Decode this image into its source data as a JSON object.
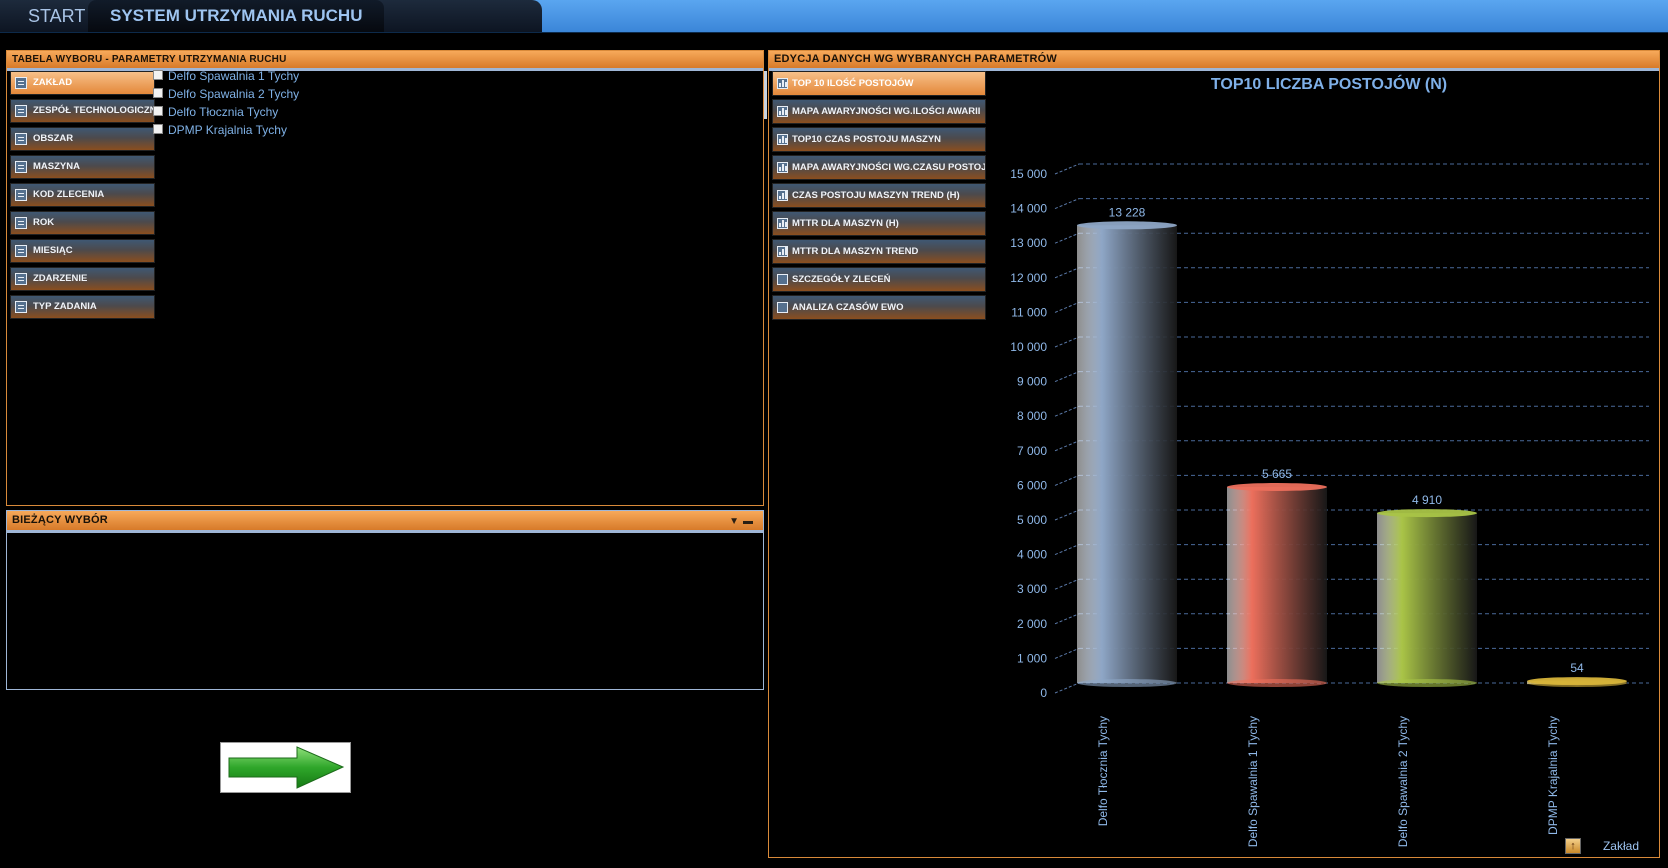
{
  "tabs": [
    {
      "label": "START"
    },
    {
      "label": "SYSTEM UTRZYMANIA RUCHU"
    }
  ],
  "select_panel": {
    "title": "TABELA WYBORU - PARAMETRY UTRZYMANIA RUCHU",
    "slicers": [
      {
        "label": "ZAKŁAD",
        "active": true
      },
      {
        "label": "ZESPÓŁ TECHNOLOGICZNY"
      },
      {
        "label": "OBSZAR"
      },
      {
        "label": "MASZYNA"
      },
      {
        "label": "KOD ZLECENIA"
      },
      {
        "label": "ROK"
      },
      {
        "label": "MIESIĄC"
      },
      {
        "label": "ZDARZENIE"
      },
      {
        "label": "TYP ZADANIA"
      }
    ],
    "items": [
      {
        "label": "Delfo Spawalnia 1 Tychy"
      },
      {
        "label": "Delfo Spawalnia 2 Tychy"
      },
      {
        "label": "Delfo Tłocznia Tychy"
      },
      {
        "label": "DPMP Krajalnia Tychy"
      }
    ]
  },
  "current_panel": {
    "title": "BIEŻĄCY WYBÓR"
  },
  "chart_panel": {
    "title": "EDYCJA DANYCH WG WYBRANYCH PARAMETRÓW",
    "reports": [
      {
        "label": "TOP 10 ILOŚĆ POSTOJÓW",
        "icon": "bar-chart-icon",
        "active": true
      },
      {
        "label": "MAPA AWARYJNOŚCI WG.ILOŚCI AWARII",
        "icon": "bar-chart-icon"
      },
      {
        "label": "TOP10 CZAS POSTOJU MASZYN",
        "icon": "bar-chart-icon"
      },
      {
        "label": "MAPA AWARYJNOŚCI WG.CZASU POSTOJU",
        "icon": "bar-chart-icon"
      },
      {
        "label": "CZAS POSTOJU MASZYN TREND (H)",
        "icon": "line-chart-icon"
      },
      {
        "label": "MTTR DLA MASZYN (H)",
        "icon": "bar-chart-icon"
      },
      {
        "label": "MTTR DLA MASZYN TREND",
        "icon": "line-chart-icon"
      },
      {
        "label": "SZCZEGÓŁY ZLECEŃ",
        "icon": "table-icon"
      },
      {
        "label": "ANALIZA CZASÓW EWO",
        "icon": "table-icon"
      }
    ],
    "footer_label": "Zakład"
  },
  "chart_data": {
    "type": "bar",
    "title": "TOP10 LICZBA POSTOJÓW (N)",
    "categories": [
      "Delfo Tłocznia Tychy",
      "Delfo Spawalnia 1 Tychy",
      "Delfo Spawalnia 2 Tychy",
      "DPMP Krajalnia Tychy"
    ],
    "values": [
      13228,
      5665,
      4910,
      54
    ],
    "value_labels": [
      "13 228",
      "5 665",
      "4 910",
      "54"
    ],
    "colors": [
      "#8ea6c6",
      "#ec6f5c",
      "#a9c447",
      "#d7b43a"
    ],
    "ylim": [
      0,
      15000
    ],
    "yticks": [
      0,
      1000,
      2000,
      3000,
      4000,
      5000,
      6000,
      7000,
      8000,
      9000,
      10000,
      11000,
      12000,
      13000,
      14000,
      15000
    ],
    "ytick_labels": [
      "0",
      "1 000",
      "2 000",
      "3 000",
      "4 000",
      "5 000",
      "6 000",
      "7 000",
      "8 000",
      "9 000",
      "10 000",
      "11 000",
      "12 000",
      "13 000",
      "14 000",
      "15 000"
    ],
    "grid": true,
    "title_color": "#7fb0e8",
    "label_color": "#8fb8e8"
  }
}
